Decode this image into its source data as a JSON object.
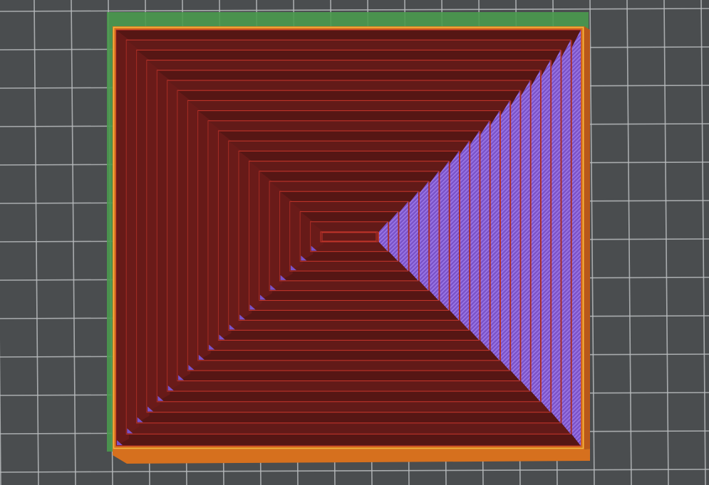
{
  "viewport": {
    "type": "3d-print-slicer-preview",
    "camera": "top-down",
    "background_color": "#4a4d4f",
    "bed_grid_color": "#b9bcbe",
    "shadow_color": "#4a9a4e"
  },
  "model": {
    "shape": "stepped-square-pyramid-pocket",
    "visible_step_count": 20,
    "colors": {
      "outer_wall": "#d6701e",
      "outer_wall_highlight": "#f2b640",
      "wall_edge": "#c0342a",
      "floor": "#561614",
      "floor_alt": "#621a18",
      "inner_wall": "#6e1c1a",
      "overhang": "#7a52c8",
      "overhang_stripe": "#9c78e6"
    }
  }
}
